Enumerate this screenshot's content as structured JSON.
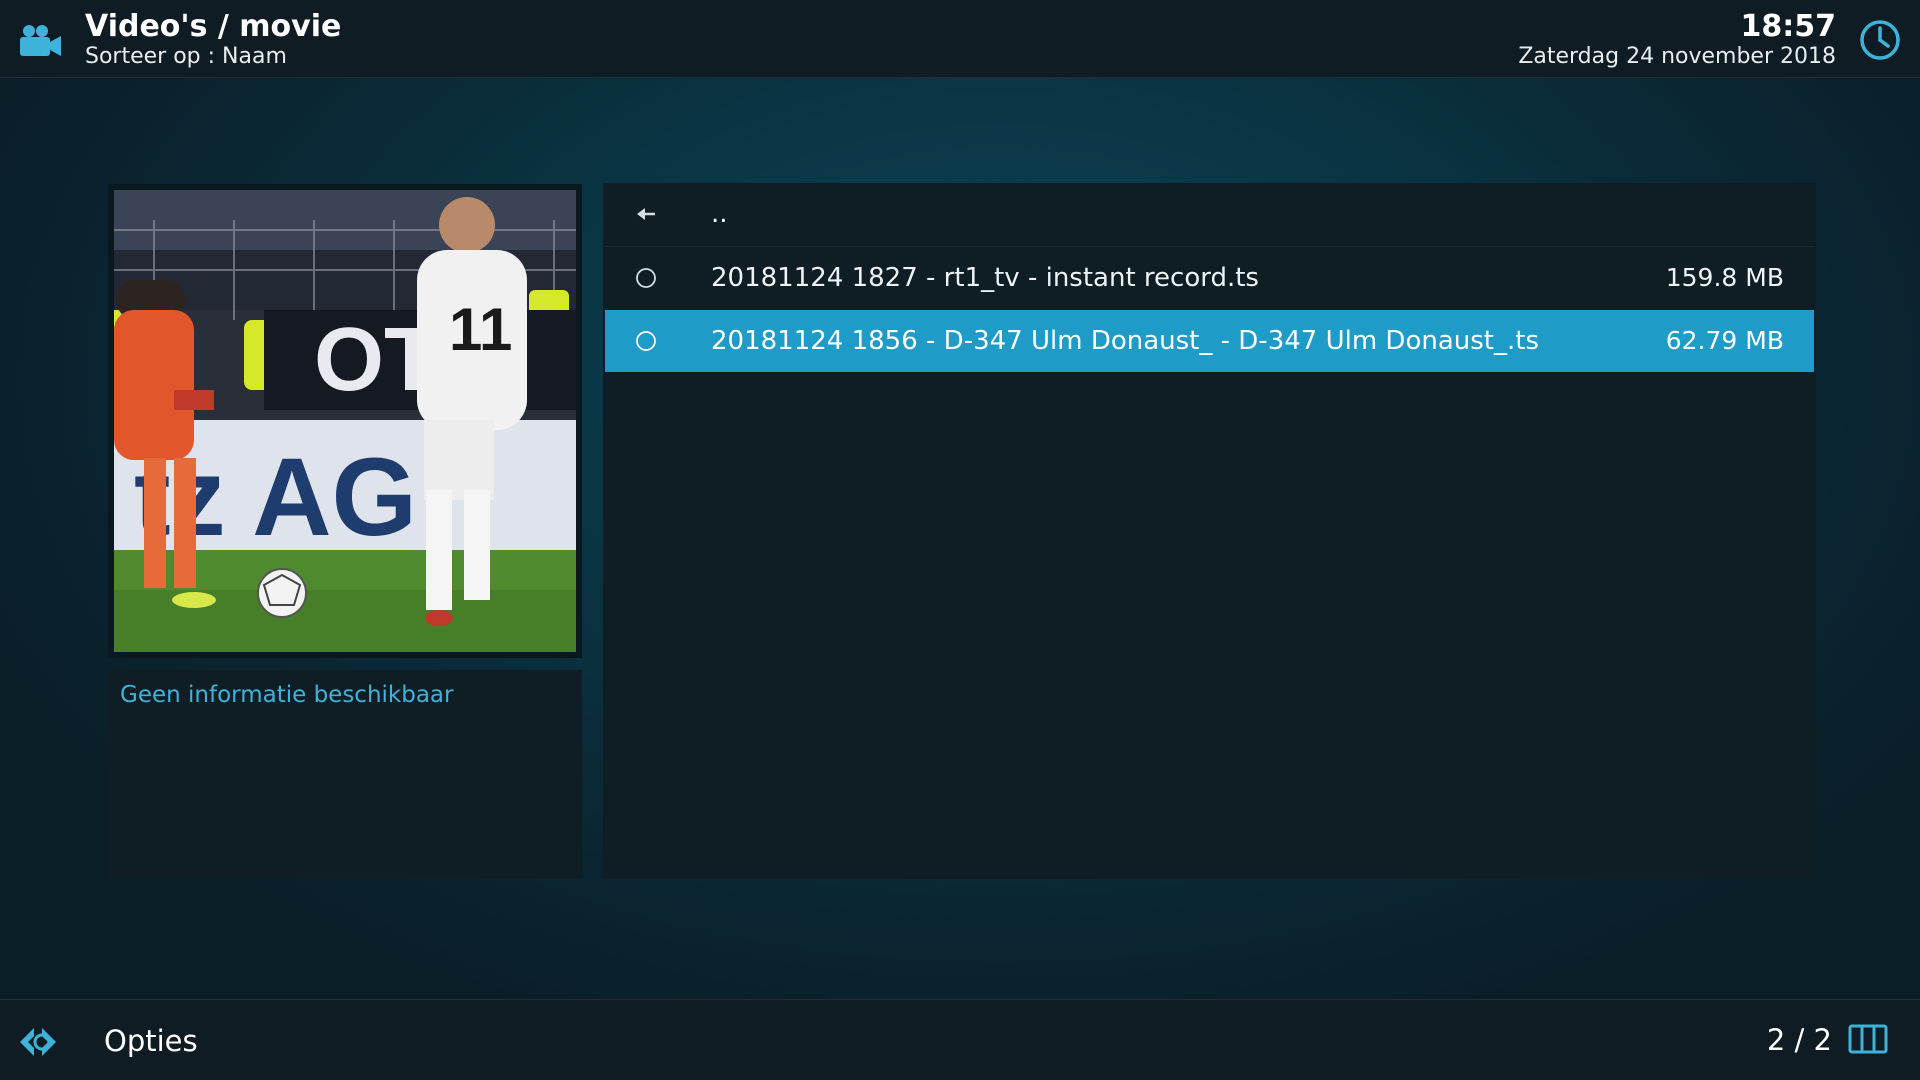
{
  "header": {
    "title": "Video's / movie",
    "subtitle": "Sorteer op : Naam",
    "time": "18:57",
    "date": "Zaterdag 24 november 2018",
    "icon": "video-camera-icon",
    "clock_icon": "clock-icon"
  },
  "info": {
    "text": "Geen informatie beschikbaar"
  },
  "list": {
    "parent_label": "..",
    "items": [
      {
        "label": "20181124 1827 - rt1_tv - instant record.ts",
        "size": "159.8 MB",
        "selected": false
      },
      {
        "label": "20181124 1856 - D-347 Ulm Donaust_ - D-347 Ulm Donaust_.ts",
        "size": "62.79 MB",
        "selected": true
      }
    ]
  },
  "footer": {
    "options_label": "Opties",
    "page_count": "2 / 2"
  },
  "colors": {
    "accent": "#1f9bc7",
    "info_text": "#3eb3da",
    "bar_bg": "#101c24",
    "panel_bg": "#0f1d25"
  }
}
